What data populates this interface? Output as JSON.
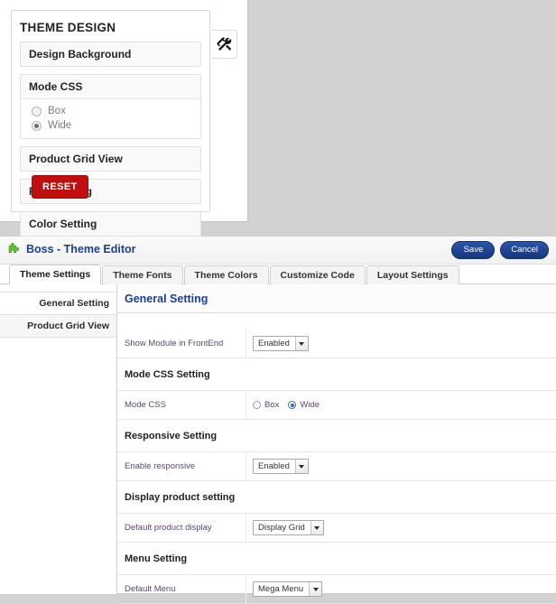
{
  "frontend": {
    "title": "THEME DESIGN",
    "tools_icon": "hammer-and-wrench-icon",
    "sections": [
      {
        "label": "Design Background"
      },
      {
        "label": "Mode CSS"
      },
      {
        "label": "Product Grid View"
      },
      {
        "label": "Font Setting"
      },
      {
        "label": "Color Setting"
      }
    ],
    "mode_css": {
      "options": [
        {
          "label": "Box",
          "selected": false
        },
        {
          "label": "Wide",
          "selected": true
        }
      ]
    },
    "reset_label": "RESET",
    "accent_red": "#c00d0d"
  },
  "admin": {
    "icon": "green-puzzle-piece-icon",
    "title": "Boss - Theme Editor",
    "title_color": "#1c3f94",
    "actions": [
      {
        "label": "Save",
        "name": "save-button"
      },
      {
        "label": "Cancel",
        "name": "cancel-button"
      }
    ],
    "tabs": [
      {
        "label": "Theme Settings",
        "active": true
      },
      {
        "label": "Theme Fonts",
        "active": false
      },
      {
        "label": "Theme Colors",
        "active": false
      },
      {
        "label": "Customize Code",
        "active": false
      },
      {
        "label": "Layout Settings",
        "active": false
      }
    ],
    "sidebar": [
      {
        "label": "General Setting",
        "active": true
      },
      {
        "label": "Product Grid View",
        "active": false
      }
    ],
    "content_title": "General Setting",
    "fields": {
      "show_module": {
        "label": "Show Module in FrontEnd",
        "value": "Enabled"
      },
      "mode_css_heading": "Mode CSS Setting",
      "mode_css": {
        "label": "Mode CSS",
        "options": [
          {
            "label": "Box",
            "selected": false
          },
          {
            "label": "Wide",
            "selected": true
          }
        ]
      },
      "responsive_heading": "Responsive Setting",
      "enable_responsive": {
        "label": "Enable responsive",
        "value": "Enabled"
      },
      "display_product_heading": "Display product setting",
      "default_product_display": {
        "label": "Default product display",
        "value": "Display Grid"
      },
      "menu_heading": "Menu Setting",
      "default_menu": {
        "label": "Default Menu",
        "value": "Mega Menu"
      }
    }
  }
}
